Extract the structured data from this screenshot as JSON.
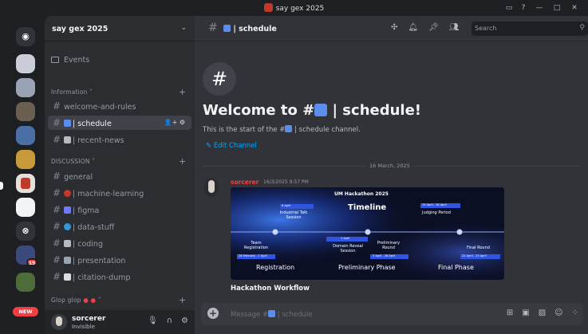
{
  "window": {
    "title": "say gex 2025",
    "controls": [
      "inbox-icon",
      "help-icon",
      "minimize",
      "maximize",
      "close"
    ]
  },
  "server_rail": {
    "badges": [
      "15"
    ],
    "new_label": "NEW"
  },
  "sidebar": {
    "guild_name": "say gex 2025",
    "events_label": "Events",
    "categories": [
      {
        "label": "Information ˅",
        "plus": "+"
      },
      {
        "label": "DISCUSSION ˅",
        "plus": "+"
      },
      {
        "label": "Glop glop",
        "plus": "+"
      }
    ],
    "channels": [
      {
        "name": "welcome-and-rules"
      },
      {
        "name": "| schedule",
        "emoji_color": "#5b8def"
      },
      {
        "name": "| recent-news",
        "emoji_color": "#b5bac1"
      },
      {
        "name": "general"
      },
      {
        "name": "| machine-learning",
        "emoji_color": "#c0392b"
      },
      {
        "name": "| figma",
        "emoji_color": "#6f7bf7"
      },
      {
        "name": "| data-stuff",
        "emoji_color": "#3498db"
      },
      {
        "name": "| coding",
        "emoji_color": "#b5bac1"
      },
      {
        "name": "| presentation",
        "emoji_color": "#9aa4b1"
      },
      {
        "name": "| citation-dump",
        "emoji_color": "#dbdee1"
      }
    ]
  },
  "user": {
    "name": "sorcerer",
    "status": "Invisible"
  },
  "header": {
    "channel": "| schedule",
    "search_placeholder": "Search"
  },
  "welcome": {
    "title_prefix": "Welcome to #",
    "title_suffix": "| schedule!",
    "subtitle_prefix": "This is the start of the #",
    "subtitle_suffix": "| schedule channel.",
    "edit_label": "Edit Channel"
  },
  "divider_date": "16 March, 2025",
  "message": {
    "author": "sorcerer",
    "timestamp": "16/3/2025 9:57 PM",
    "attachment": {
      "brand": "UM Hackathon 2025",
      "heading": "Timeline",
      "events": [
        {
          "label": "Industrial Talk Session",
          "date": "8 April"
        },
        {
          "label": "Judging Period",
          "date": "15 April - 16 April"
        },
        {
          "label": "Team Registration",
          "date": "28 February - 1 April"
        },
        {
          "label": "Domain Reveal Session",
          "date": "1 April"
        },
        {
          "label": "Preliminary Round",
          "date": "3 April - 16 April"
        },
        {
          "label": "Final Round",
          "date": "22 April - 23 April"
        }
      ],
      "phases": [
        "Registration",
        "Preliminary Phase",
        "Final Phase"
      ]
    },
    "caption": "Hackathon Workflow"
  },
  "composer": {
    "placeholder_prefix": "Message #",
    "placeholder_suffix": "| schedule"
  },
  "colors": {
    "accent_blue": "#00a8fc",
    "author_red": "#f23f43",
    "background": "#313338"
  }
}
